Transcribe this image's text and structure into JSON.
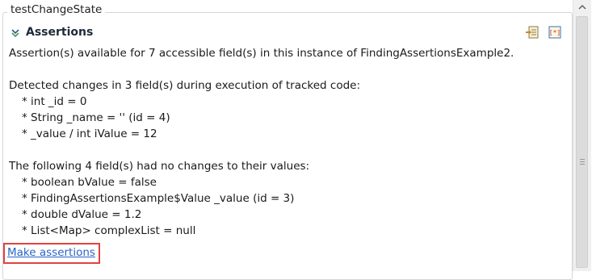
{
  "group": {
    "title": "testChangeState"
  },
  "section": {
    "title": "Assertions",
    "toolbar": [
      {
        "icon": "import-icon"
      },
      {
        "icon": "assertion-config-icon"
      }
    ]
  },
  "content": {
    "summary": "Assertion(s) available for 7 accessible field(s) in this instance of FindingAssertionsExample2.",
    "changes_header": "Detected changes in 3 field(s) during execution of tracked code:",
    "changes": [
      "* int _id = 0",
      "* String _name = '' (id = 4)",
      "* _value / int iValue = 12"
    ],
    "unchanged_header": "The following 4 field(s) had no changes to their values:",
    "unchanged": [
      "* boolean bValue = false",
      "* FindingAssertionsExample$Value _value (id = 3)",
      "* double dValue = 1.2",
      "* List<Map> complexList = null"
    ],
    "link": "Make assertions"
  },
  "colors": {
    "link": "#2a63c7",
    "highlight": "#e0433e"
  }
}
